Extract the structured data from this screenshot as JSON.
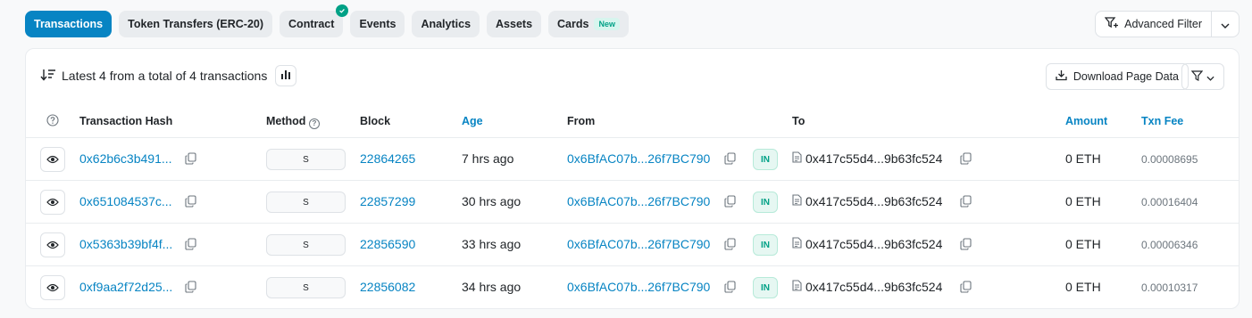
{
  "tabs": [
    {
      "label": "Transactions"
    },
    {
      "label": "Token Transfers (ERC-20)"
    },
    {
      "label": "Contract"
    },
    {
      "label": "Events"
    },
    {
      "label": "Analytics"
    },
    {
      "label": "Assets"
    },
    {
      "label": "Cards",
      "badge": "New"
    }
  ],
  "advanced_filter": {
    "label": "Advanced Filter"
  },
  "summary": {
    "text": "Latest 4 from a total of 4 transactions"
  },
  "download_button": {
    "label": "Download Page Data"
  },
  "columns": {
    "hash": "Transaction Hash",
    "method": "Method",
    "block": "Block",
    "age": "Age",
    "from": "From",
    "to": "To",
    "amount": "Amount",
    "fee": "Txn Fee"
  },
  "rows": [
    {
      "hash": "0x62b6c3b491...",
      "method": "S",
      "block": "22864265",
      "age": "7 hrs ago",
      "from": "0x6BfAC07b...26f7BC790",
      "direction": "IN",
      "to": "0x417c55d4...9b63fc524",
      "amount": "0 ETH",
      "fee": "0.00008695"
    },
    {
      "hash": "0x651084537c...",
      "method": "S",
      "block": "22857299",
      "age": "30 hrs ago",
      "from": "0x6BfAC07b...26f7BC790",
      "direction": "IN",
      "to": "0x417c55d4...9b63fc524",
      "amount": "0 ETH",
      "fee": "0.00016404"
    },
    {
      "hash": "0x5363b39bf4f...",
      "method": "S",
      "block": "22856590",
      "age": "33 hrs ago",
      "from": "0x6BfAC07b...26f7BC790",
      "direction": "IN",
      "to": "0x417c55d4...9b63fc524",
      "amount": "0 ETH",
      "fee": "0.00006346"
    },
    {
      "hash": "0xf9aa2f72d25...",
      "method": "S",
      "block": "22856082",
      "age": "34 hrs ago",
      "from": "0x6BfAC07b...26f7BC790",
      "direction": "IN",
      "to": "0x417c55d4...9b63fc524",
      "amount": "0 ETH",
      "fee": "0.00010317"
    }
  ],
  "colors": {
    "accent": "#0784c3",
    "success": "#00a186"
  }
}
